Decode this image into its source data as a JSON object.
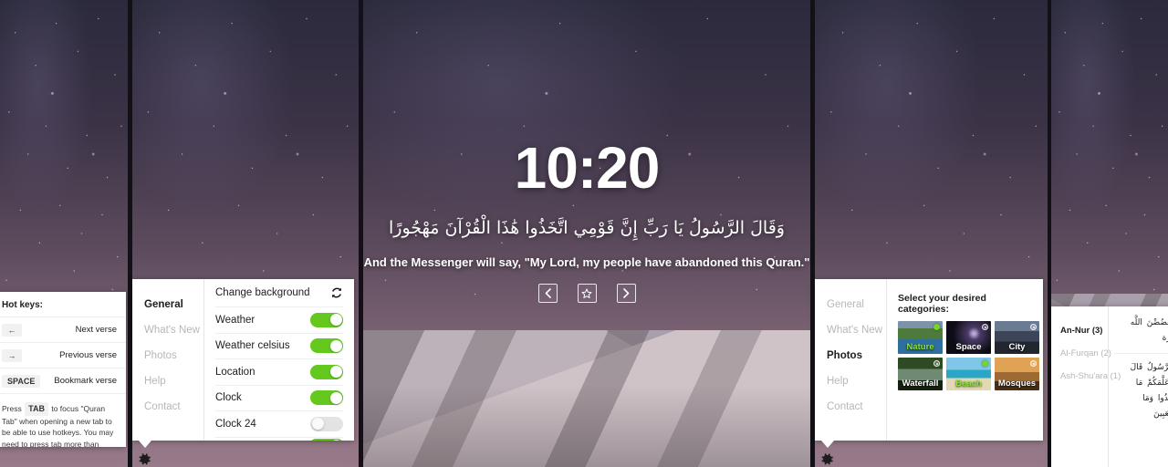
{
  "app": {
    "clock": "10:20",
    "ayah_arabic": "وَقَالَ الرَّسُولُ يَا رَبِّ إِنَّ قَوْمِي اتَّخَذُوا هَٰذَا الْقُرْآنَ مَهْجُورًا",
    "ayah_translation": "And the Messenger will say, \"My Lord, my people have abandoned this Quran.\"",
    "nav": {
      "prev_icon": "chevron-left-icon",
      "bookmark_icon": "star-icon",
      "next_icon": "chevron-right-icon"
    }
  },
  "hotkeys_panel": {
    "title": "Hot keys:",
    "rows": [
      {
        "key": "←",
        "action": "Next verse"
      },
      {
        "key": "→",
        "action": "Previous verse"
      },
      {
        "key": "SPACE",
        "action": "Bookmark verse"
      }
    ],
    "note_before": "Press",
    "note_key": "TAB",
    "note_after": "to focus \"Quran Tab\" when opening a new tab to be able to use hotkeys. You may need to press tab more than once."
  },
  "settings_panel": {
    "nav": [
      {
        "label": "General",
        "active": true
      },
      {
        "label": "What's New",
        "active": false
      },
      {
        "label": "Photos",
        "active": false
      },
      {
        "label": "Help",
        "active": false
      },
      {
        "label": "Contact",
        "active": false
      }
    ],
    "change_background_label": "Change background",
    "refresh_icon": "refresh-icon",
    "toggles": [
      {
        "label": "Weather",
        "on": true
      },
      {
        "label": "Weather celsius",
        "on": true
      },
      {
        "label": "Location",
        "on": true
      },
      {
        "label": "Clock",
        "on": true
      },
      {
        "label": "Clock 24",
        "on": false
      }
    ],
    "gear_icon": "gear-icon"
  },
  "photos_panel": {
    "nav": [
      {
        "label": "General",
        "active": false
      },
      {
        "label": "What's New",
        "active": false
      },
      {
        "label": "Photos",
        "active": true
      },
      {
        "label": "Help",
        "active": false
      },
      {
        "label": "Contact",
        "active": false
      }
    ],
    "title": "Select your desired categories:",
    "categories": [
      {
        "label": "Nature",
        "selected": true,
        "theme": "bg-nature"
      },
      {
        "label": "Space",
        "selected": false,
        "theme": "bg-space"
      },
      {
        "label": "City",
        "selected": false,
        "theme": "bg-city"
      },
      {
        "label": "Waterfall",
        "selected": false,
        "theme": "bg-waterfall"
      },
      {
        "label": "Beach",
        "selected": true,
        "theme": "bg-beach"
      },
      {
        "label": "Mosques",
        "selected": false,
        "theme": "bg-mosques"
      }
    ],
    "gear_icon": "gear-icon"
  },
  "surah_panel": {
    "items": [
      {
        "label": "An-Nur (3)",
        "active": true
      },
      {
        "label": "Al-Furqan (2)",
        "active": false
      },
      {
        "label": "Ash-Shu'ara (1)",
        "active": false
      }
    ],
    "verses": [
      "يَغْضُضْنَ اللَّه",
      "ـرَة",
      "الرَّسُولُ قَالَ",
      "وَعَلَّمَكُمْ مَا",
      "خَذُوا وَمَا",
      "الْعَبِينَ"
    ]
  },
  "colors": {
    "toggle_on": "#64c81e",
    "toggle_off": "#e3e3e3",
    "selected_label": "#8ae234",
    "card_bg": "#ffffff",
    "nav_inactive": "#b7b7b7",
    "nav_active": "#1d1d1d"
  }
}
